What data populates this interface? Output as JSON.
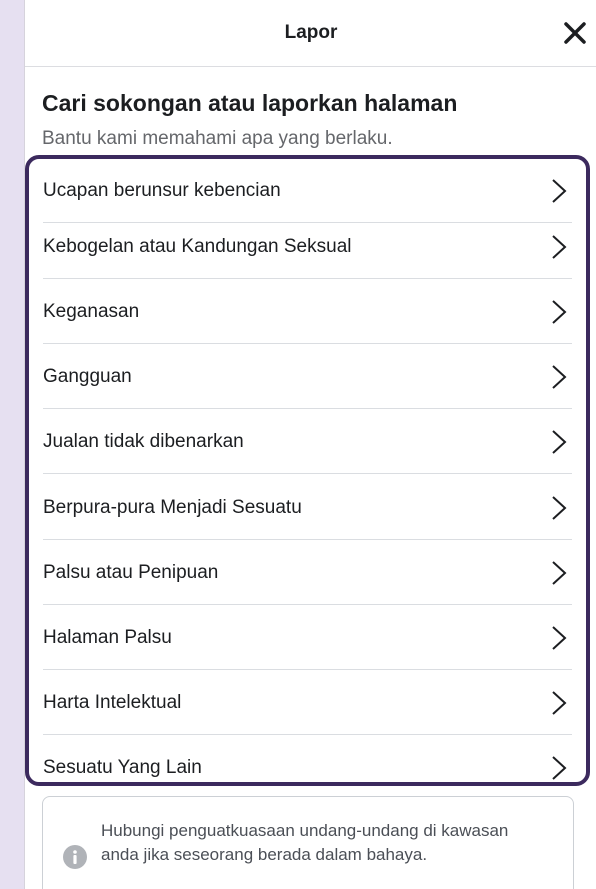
{
  "header": {
    "title": "Lapor",
    "close_icon": "close-icon"
  },
  "main": {
    "heading": "Cari sokongan atau laporkan halaman",
    "subheading": "Bantu kami memahami apa yang berlaku.",
    "options": [
      "Ucapan berunsur kebencian",
      "Kebogelan atau Kandungan Seksual",
      "Keganasan",
      "Gangguan",
      "Jualan tidak dibenarkan",
      "Berpura-pura Menjadi Sesuatu",
      "Palsu atau Penipuan",
      "Halaman Palsu",
      "Harta Intelektual",
      "Sesuatu Yang Lain"
    ]
  },
  "info": {
    "icon": "info-icon",
    "text": "Hubungi penguatkuasaan undang-undang di kawasan anda jika seseorang berada dalam bahaya."
  },
  "colors": {
    "highlight_border": "#3c2a5e",
    "background": "#e6e0f1",
    "text": "#1c1e21"
  }
}
